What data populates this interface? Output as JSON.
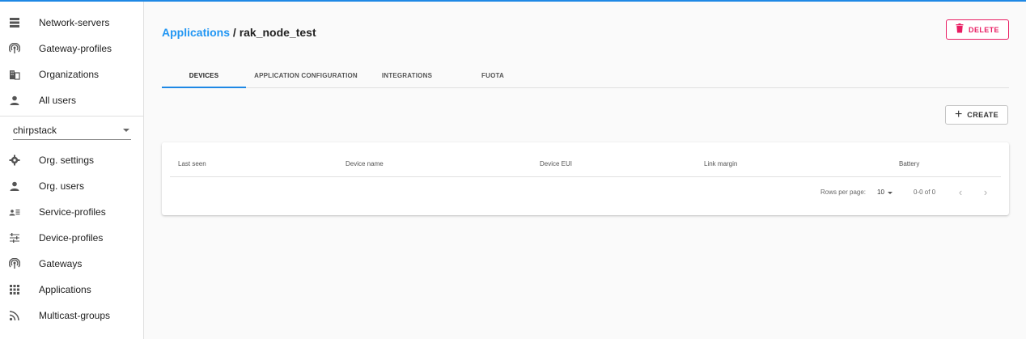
{
  "sidebar": {
    "top_items": [
      {
        "label": "Network-servers",
        "icon": "server-icon"
      },
      {
        "label": "Gateway-profiles",
        "icon": "radio-tower-icon"
      },
      {
        "label": "Organizations",
        "icon": "building-icon"
      },
      {
        "label": "All users",
        "icon": "user-icon"
      }
    ],
    "org_select": {
      "value": "chirpstack"
    },
    "org_items": [
      {
        "label": "Org. settings",
        "icon": "gear-icon"
      },
      {
        "label": "Org. users",
        "icon": "user-icon"
      },
      {
        "label": "Service-profiles",
        "icon": "user-list-icon"
      },
      {
        "label": "Device-profiles",
        "icon": "sliders-icon"
      },
      {
        "label": "Gateways",
        "icon": "radio-tower-icon"
      },
      {
        "label": "Applications",
        "icon": "apps-grid-icon"
      },
      {
        "label": "Multicast-groups",
        "icon": "rss-icon"
      }
    ]
  },
  "header": {
    "breadcrumb_link": "Applications",
    "separator": "/",
    "current": "rak_node_test",
    "delete_label": "DELETE"
  },
  "tabs": [
    {
      "label": "DEVICES",
      "active": true
    },
    {
      "label": "APPLICATION CONFIGURATION",
      "active": false
    },
    {
      "label": "INTEGRATIONS",
      "active": false
    },
    {
      "label": "FUOTA",
      "active": false
    }
  ],
  "toolbar": {
    "create_label": "CREATE"
  },
  "table": {
    "columns": [
      "Last seen",
      "Device name",
      "Device EUI",
      "Link margin",
      "Battery"
    ],
    "pagination": {
      "rows_per_page_label": "Rows per page:",
      "rows_per_page": "10",
      "range": "0-0 of 0",
      "prev": "‹",
      "next": "›"
    }
  },
  "colors": {
    "accent": "#1e88e5",
    "link": "#2196f3",
    "danger": "#e91e63"
  }
}
